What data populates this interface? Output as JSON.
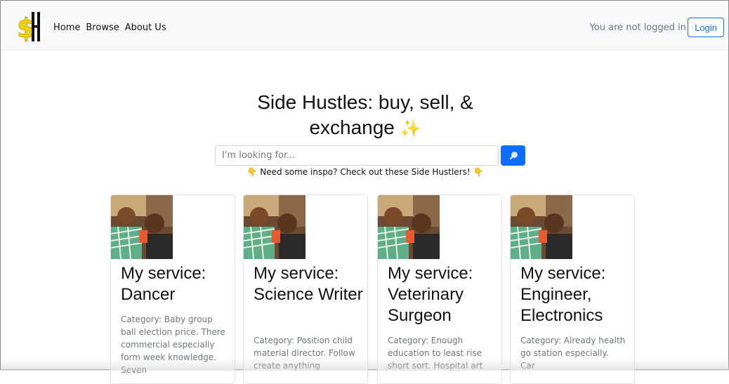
{
  "nav": {
    "links": [
      "Home",
      "Browse",
      "About Us"
    ],
    "status_text": "You are not logged in",
    "login_label": "Login"
  },
  "hero": {
    "title_line1": "Side Hustles: buy, sell, &",
    "title_line2": "exchange",
    "sparkle": "✨"
  },
  "search": {
    "placeholder": "I'm looking for...",
    "button_icon": "search-icon"
  },
  "inspo": {
    "text": "Need some inspo? Check out these Side Hustlers!",
    "hand": "👇"
  },
  "cards": [
    {
      "title": "My service: Dancer",
      "text": "Category: Baby group ball election price. There commercial especially form week knowledge. Seven"
    },
    {
      "title": "My service: Science Writer",
      "text": "Category: Position child material director. Follow create anything"
    },
    {
      "title": "My service: Veterinary Surgeon",
      "text": "Category: Enough education to least rise short sort. Hospital art"
    },
    {
      "title": "My service: Engineer, Electronics",
      "text": "Category: Already health go station especially. Car"
    }
  ],
  "colors": {
    "primary": "#0d6efd",
    "navbar_bg": "#f8f9fa",
    "logo_gold": "#f5d300"
  }
}
